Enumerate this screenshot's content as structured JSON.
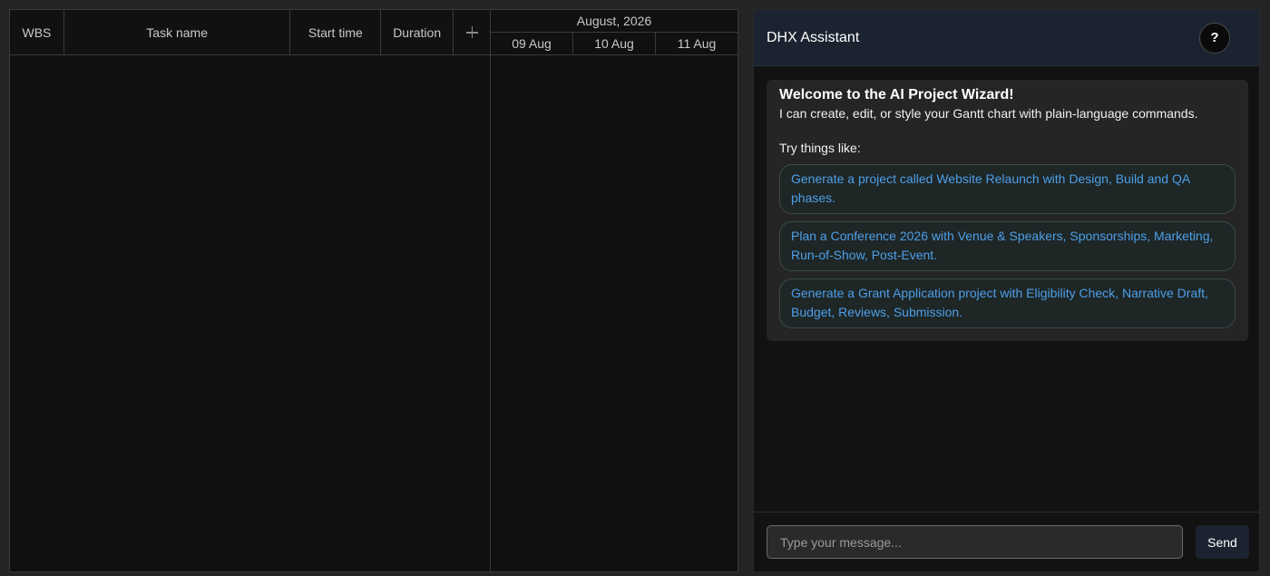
{
  "gantt": {
    "columns": {
      "wbs": "WBS",
      "task_name": "Task name",
      "start_time": "Start time",
      "duration": "Duration",
      "add_icon": "plus-icon"
    },
    "scale": {
      "month": "August, 2026",
      "days": [
        "09 Aug",
        "10 Aug",
        "11 Aug"
      ]
    }
  },
  "assistant": {
    "title": "DHX Assistant",
    "help_label": "?",
    "welcome": {
      "title": "Welcome to the AI Project Wizard!",
      "text": "I can create, edit, or style your Gantt chart with plain-language commands.",
      "try_label": "Try things like:",
      "suggestions": [
        "Generate a project called Website Relaunch with Design, Build and QA phases.",
        "Plan a Conference 2026 with Venue & Speakers, Sponsorships, Marketing, Run-of-Show, Post-Event.",
        "Generate a Grant Application project with Eligibility Check, Narrative Draft, Budget, Reviews, Submission."
      ]
    },
    "composer": {
      "placeholder": "Type your message...",
      "value": "",
      "send_label": "Send"
    }
  },
  "colors": {
    "background": "#232425",
    "panel_header": "#1c2330",
    "link": "#4d9fe8"
  }
}
